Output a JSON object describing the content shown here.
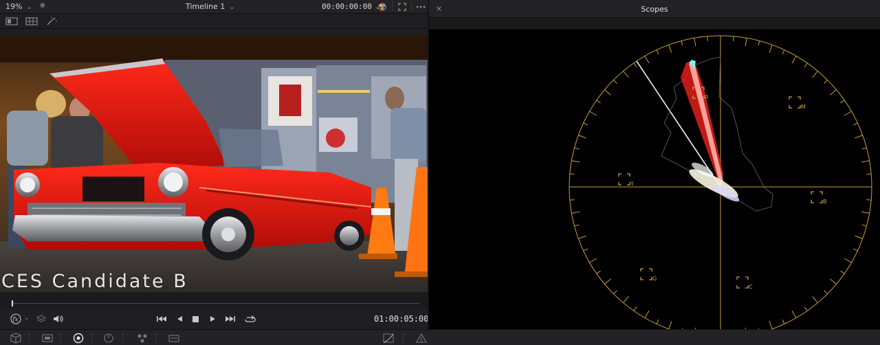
{
  "viewer": {
    "zoom": "19%",
    "timeline_name": "Timeline 1",
    "timecode_top": "00:00:00:00",
    "burn_in_text": "CES Candidate B",
    "timecode_bottom": "01:00:05:00",
    "playhead_fraction": 0.0
  },
  "scopes": {
    "title": "Scopes",
    "close_label": "×",
    "targets": {
      "R": "R",
      "M": "M",
      "B": "B",
      "C": "C",
      "G": "G",
      "Y": "Y"
    }
  },
  "colors": {
    "accent_graticule": "#c8a040",
    "panel_bg": "#1f1f21",
    "scope_bg": "#000000"
  }
}
